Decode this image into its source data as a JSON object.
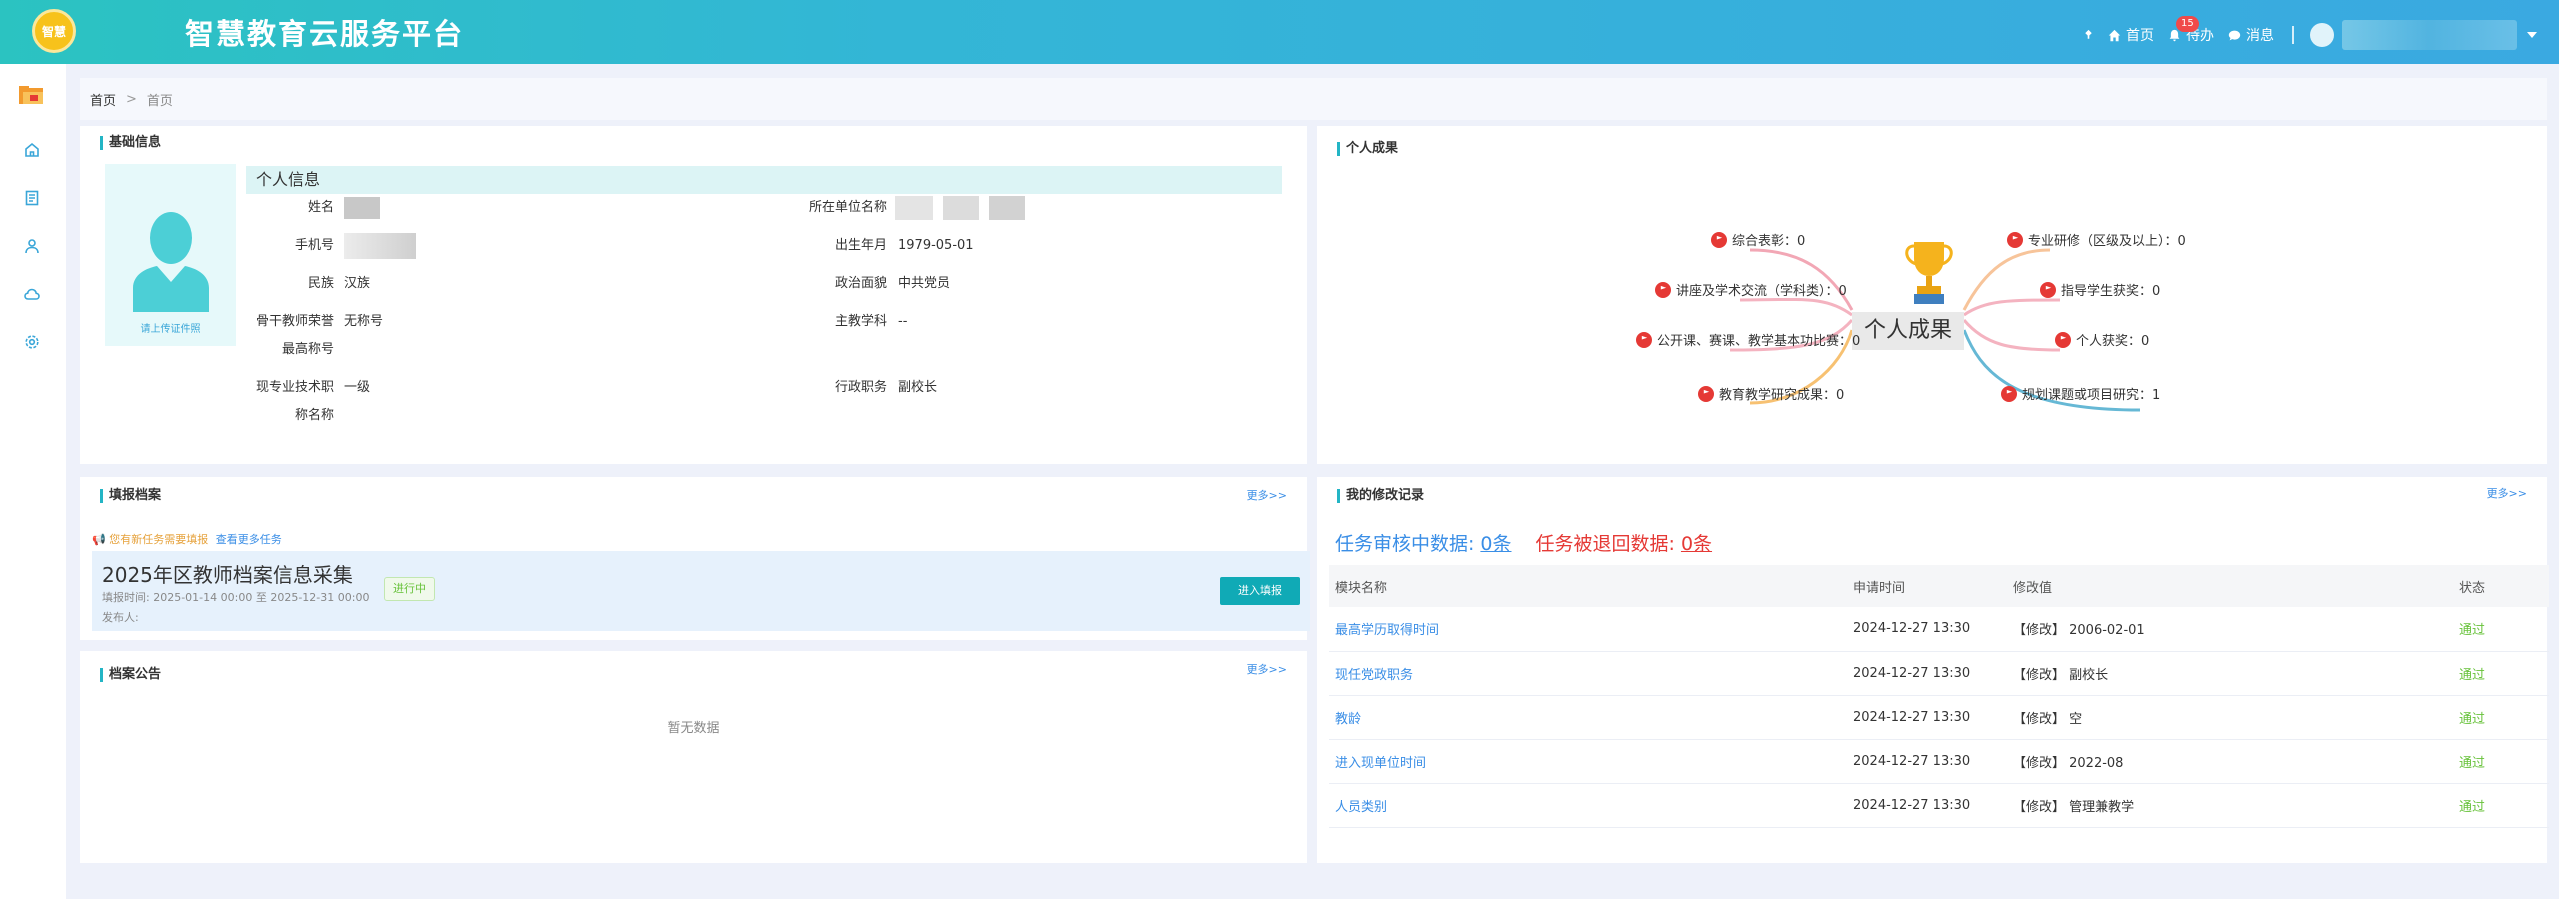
{
  "header": {
    "logo_text": "智慧",
    "app_title": "智慧教育云服务平台",
    "nav": {
      "home": "首页",
      "todo": "待办",
      "todo_badge": "15",
      "messages": "消息"
    }
  },
  "breadcrumb": {
    "root": "首页",
    "separator": ">",
    "current": "首页"
  },
  "basic_info": {
    "card_title": "基础信息",
    "upload_label": "请上传证件照",
    "section_title": "个人信息",
    "fields": {
      "name_label": "姓名",
      "unit_label": "所在单位名称",
      "phone_label": "手机号",
      "birth_label": "出生年月",
      "birth_value": "1979-05-01",
      "ethnicity_label": "民族",
      "ethnicity_value": "汉族",
      "political_label": "政治面貌",
      "political_value": "中共党员",
      "honor_label_1": "骨干教师荣誉",
      "honor_label_2": "最高称号",
      "honor_value": "无称号",
      "subject_label": "主教学科",
      "subject_value": "--",
      "title_label_1": "现专业技术职",
      "title_label_2": "称名称",
      "title_value": "一级",
      "admin_label": "行政职务",
      "admin_value": "副校长"
    }
  },
  "achievements": {
    "card_title": "个人成果",
    "center": "个人成果",
    "left": [
      "综合表彰：0",
      "讲座及学术交流（学科类）：0",
      "公开课、赛课、教学基本功比赛：0",
      "教育教学研究成果：0"
    ],
    "right": [
      "专业研修（区级及以上）：0",
      "指导学生获奖：0",
      "个人获奖：0",
      "规划课题或项目研究：1"
    ]
  },
  "filing": {
    "card_title": "填报档案",
    "more": "更多>>",
    "notice": "您有新任务需要填报",
    "notice_link": "查看更多任务",
    "task_title": "2025年区教师档案信息采集",
    "task_time": "填报时间: 2025-01-14 00:00 至 2025-12-31 00:00",
    "task_publisher": "发布人:",
    "status": "进行中",
    "enter_button": "进入填报"
  },
  "announcement": {
    "card_title": "档案公告",
    "more": "更多>>",
    "empty": "暂无数据"
  },
  "records": {
    "card_title": "我的修改记录",
    "more": "更多>>",
    "pending_label": "任务审核中数据:",
    "pending_count": "0条",
    "returned_label": "任务被退回数据:",
    "returned_count": "0条",
    "columns": [
      "模块名称",
      "申请时间",
      "修改值",
      "状态"
    ],
    "rows": [
      {
        "module": "最高学历取得时间",
        "time": "2024-12-27 13:30",
        "value": "【修改】 2006-02-01",
        "status": "通过"
      },
      {
        "module": "现任党政职务",
        "time": "2024-12-27 13:30",
        "value": "【修改】 副校长",
        "status": "通过"
      },
      {
        "module": "教龄",
        "time": "2024-12-27 13:30",
        "value": "【修改】 空",
        "status": "通过"
      },
      {
        "module": "进入现单位时间",
        "time": "2024-12-27 13:30",
        "value": "【修改】 2022-08",
        "status": "通过"
      },
      {
        "module": "人员类别",
        "time": "2024-12-27 13:30",
        "value": "【修改】 管理兼教学",
        "status": "通过"
      }
    ]
  },
  "colors": {
    "accent": "#23b5c5",
    "link": "#3a8ee6",
    "danger": "#e53935",
    "success": "#67c23a"
  }
}
